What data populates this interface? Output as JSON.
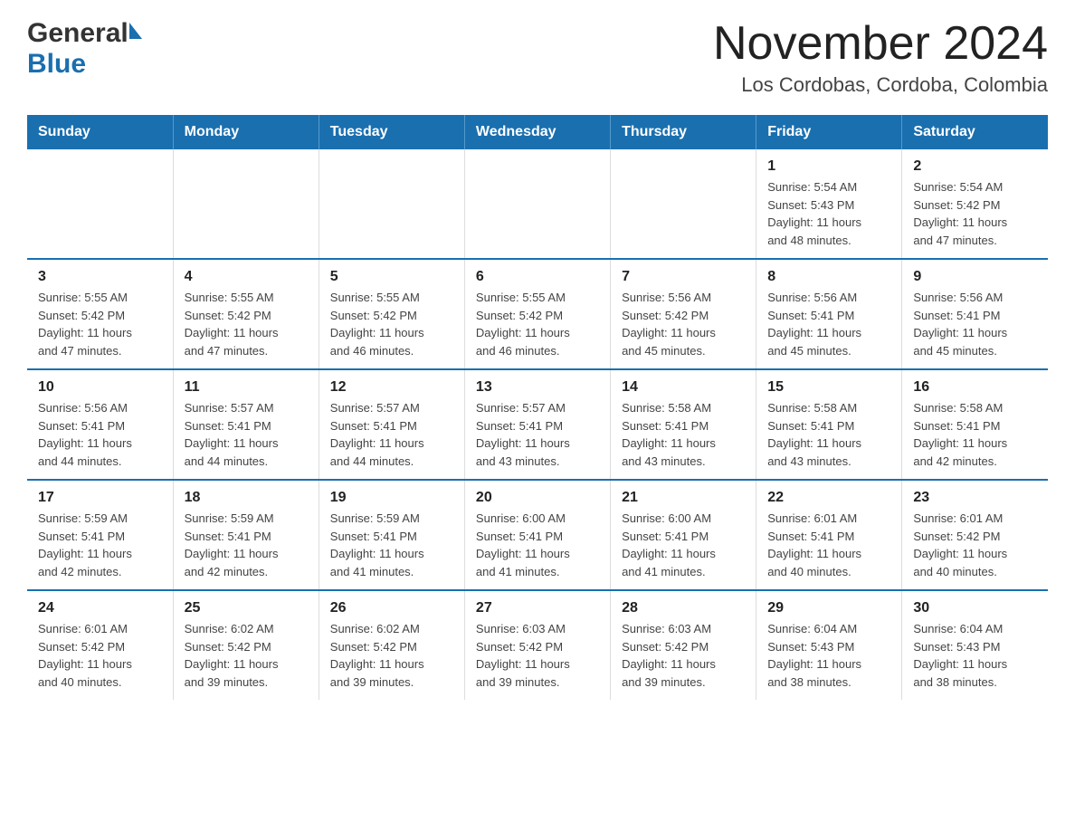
{
  "logo": {
    "general": "General",
    "blue": "Blue"
  },
  "title": "November 2024",
  "subtitle": "Los Cordobas, Cordoba, Colombia",
  "weekdays": [
    "Sunday",
    "Monday",
    "Tuesday",
    "Wednesday",
    "Thursday",
    "Friday",
    "Saturday"
  ],
  "weeks": [
    [
      {
        "day": "",
        "info": ""
      },
      {
        "day": "",
        "info": ""
      },
      {
        "day": "",
        "info": ""
      },
      {
        "day": "",
        "info": ""
      },
      {
        "day": "",
        "info": ""
      },
      {
        "day": "1",
        "info": "Sunrise: 5:54 AM\nSunset: 5:43 PM\nDaylight: 11 hours\nand 48 minutes."
      },
      {
        "day": "2",
        "info": "Sunrise: 5:54 AM\nSunset: 5:42 PM\nDaylight: 11 hours\nand 47 minutes."
      }
    ],
    [
      {
        "day": "3",
        "info": "Sunrise: 5:55 AM\nSunset: 5:42 PM\nDaylight: 11 hours\nand 47 minutes."
      },
      {
        "day": "4",
        "info": "Sunrise: 5:55 AM\nSunset: 5:42 PM\nDaylight: 11 hours\nand 47 minutes."
      },
      {
        "day": "5",
        "info": "Sunrise: 5:55 AM\nSunset: 5:42 PM\nDaylight: 11 hours\nand 46 minutes."
      },
      {
        "day": "6",
        "info": "Sunrise: 5:55 AM\nSunset: 5:42 PM\nDaylight: 11 hours\nand 46 minutes."
      },
      {
        "day": "7",
        "info": "Sunrise: 5:56 AM\nSunset: 5:42 PM\nDaylight: 11 hours\nand 45 minutes."
      },
      {
        "day": "8",
        "info": "Sunrise: 5:56 AM\nSunset: 5:41 PM\nDaylight: 11 hours\nand 45 minutes."
      },
      {
        "day": "9",
        "info": "Sunrise: 5:56 AM\nSunset: 5:41 PM\nDaylight: 11 hours\nand 45 minutes."
      }
    ],
    [
      {
        "day": "10",
        "info": "Sunrise: 5:56 AM\nSunset: 5:41 PM\nDaylight: 11 hours\nand 44 minutes."
      },
      {
        "day": "11",
        "info": "Sunrise: 5:57 AM\nSunset: 5:41 PM\nDaylight: 11 hours\nand 44 minutes."
      },
      {
        "day": "12",
        "info": "Sunrise: 5:57 AM\nSunset: 5:41 PM\nDaylight: 11 hours\nand 44 minutes."
      },
      {
        "day": "13",
        "info": "Sunrise: 5:57 AM\nSunset: 5:41 PM\nDaylight: 11 hours\nand 43 minutes."
      },
      {
        "day": "14",
        "info": "Sunrise: 5:58 AM\nSunset: 5:41 PM\nDaylight: 11 hours\nand 43 minutes."
      },
      {
        "day": "15",
        "info": "Sunrise: 5:58 AM\nSunset: 5:41 PM\nDaylight: 11 hours\nand 43 minutes."
      },
      {
        "day": "16",
        "info": "Sunrise: 5:58 AM\nSunset: 5:41 PM\nDaylight: 11 hours\nand 42 minutes."
      }
    ],
    [
      {
        "day": "17",
        "info": "Sunrise: 5:59 AM\nSunset: 5:41 PM\nDaylight: 11 hours\nand 42 minutes."
      },
      {
        "day": "18",
        "info": "Sunrise: 5:59 AM\nSunset: 5:41 PM\nDaylight: 11 hours\nand 42 minutes."
      },
      {
        "day": "19",
        "info": "Sunrise: 5:59 AM\nSunset: 5:41 PM\nDaylight: 11 hours\nand 41 minutes."
      },
      {
        "day": "20",
        "info": "Sunrise: 6:00 AM\nSunset: 5:41 PM\nDaylight: 11 hours\nand 41 minutes."
      },
      {
        "day": "21",
        "info": "Sunrise: 6:00 AM\nSunset: 5:41 PM\nDaylight: 11 hours\nand 41 minutes."
      },
      {
        "day": "22",
        "info": "Sunrise: 6:01 AM\nSunset: 5:41 PM\nDaylight: 11 hours\nand 40 minutes."
      },
      {
        "day": "23",
        "info": "Sunrise: 6:01 AM\nSunset: 5:42 PM\nDaylight: 11 hours\nand 40 minutes."
      }
    ],
    [
      {
        "day": "24",
        "info": "Sunrise: 6:01 AM\nSunset: 5:42 PM\nDaylight: 11 hours\nand 40 minutes."
      },
      {
        "day": "25",
        "info": "Sunrise: 6:02 AM\nSunset: 5:42 PM\nDaylight: 11 hours\nand 39 minutes."
      },
      {
        "day": "26",
        "info": "Sunrise: 6:02 AM\nSunset: 5:42 PM\nDaylight: 11 hours\nand 39 minutes."
      },
      {
        "day": "27",
        "info": "Sunrise: 6:03 AM\nSunset: 5:42 PM\nDaylight: 11 hours\nand 39 minutes."
      },
      {
        "day": "28",
        "info": "Sunrise: 6:03 AM\nSunset: 5:42 PM\nDaylight: 11 hours\nand 39 minutes."
      },
      {
        "day": "29",
        "info": "Sunrise: 6:04 AM\nSunset: 5:43 PM\nDaylight: 11 hours\nand 38 minutes."
      },
      {
        "day": "30",
        "info": "Sunrise: 6:04 AM\nSunset: 5:43 PM\nDaylight: 11 hours\nand 38 minutes."
      }
    ]
  ]
}
